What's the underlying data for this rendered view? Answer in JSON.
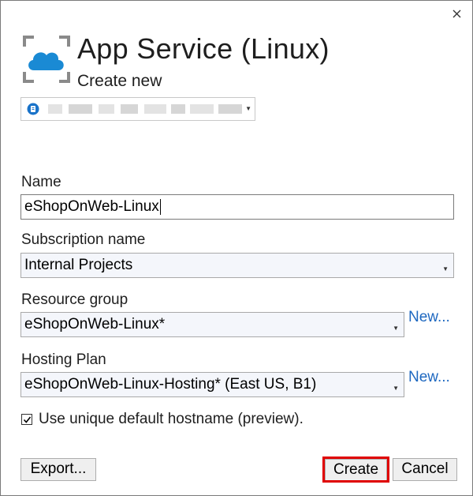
{
  "window": {
    "title": "App Service (Linux)",
    "subtitle": "Create new",
    "close_icon": "close-icon"
  },
  "account": {
    "icon": "account-badge-icon",
    "value_obscured": true
  },
  "form": {
    "name_label": "Name",
    "name_value": "eShopOnWeb-Linux",
    "subscription_label": "Subscription name",
    "subscription_value": "Internal Projects",
    "resource_group_label": "Resource group",
    "resource_group_value": "eShopOnWeb-Linux*",
    "resource_group_new": "New...",
    "hosting_plan_label": "Hosting Plan",
    "hosting_plan_value": "eShopOnWeb-Linux-Hosting* (East US, B1)",
    "hosting_plan_new": "New...",
    "unique_hostname_label": "Use unique default hostname (preview).",
    "unique_hostname_checked": true
  },
  "buttons": {
    "export": "Export...",
    "create": "Create",
    "cancel": "Cancel"
  },
  "colors": {
    "link": "#1e68c0",
    "highlight": "#e00000",
    "cloud": "#1a8ad4"
  }
}
